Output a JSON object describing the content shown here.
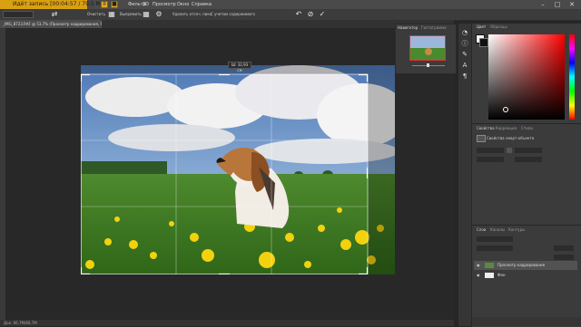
{
  "recorder": {
    "status": "Идёт запись [00:04:57 / 79,5 Мб]"
  },
  "menu": [
    "Фильтр",
    "3D",
    "Просмотр",
    "Окно",
    "Справка"
  ],
  "options": {
    "clear": "Очистить",
    "straighten": "Выпрямить",
    "delete_cropped": "Удалить отсеч. пикс.",
    "content_aware": "С учетом содержимого"
  },
  "document_tab": "_IMG_8723.RAF @ 53,7% (Просмотр кадрирования, RGB/8) *",
  "crop_tooltip": "Ш: 32,93 см",
  "navigator": {
    "tab1": "Навигатор",
    "tab2": "Гистограмма"
  },
  "color_panel": {
    "tab1": "Цвет",
    "tab2": "Образцы"
  },
  "properties": {
    "tab1": "Свойства",
    "tab2": "Коррекция",
    "tab3": "Стили",
    "title": "Свойства смарт-объекта"
  },
  "layers": {
    "tab1": "Слои",
    "tab2": "Каналы",
    "tab3": "Контуры",
    "items": [
      {
        "name": "Просмотр кадрирования"
      },
      {
        "name": "Фон"
      }
    ]
  },
  "status": "Док: 66,7M/66,7M",
  "colors": {
    "accent": "#d9a011",
    "bg": "#262626",
    "panel": "#3b3b3b"
  }
}
